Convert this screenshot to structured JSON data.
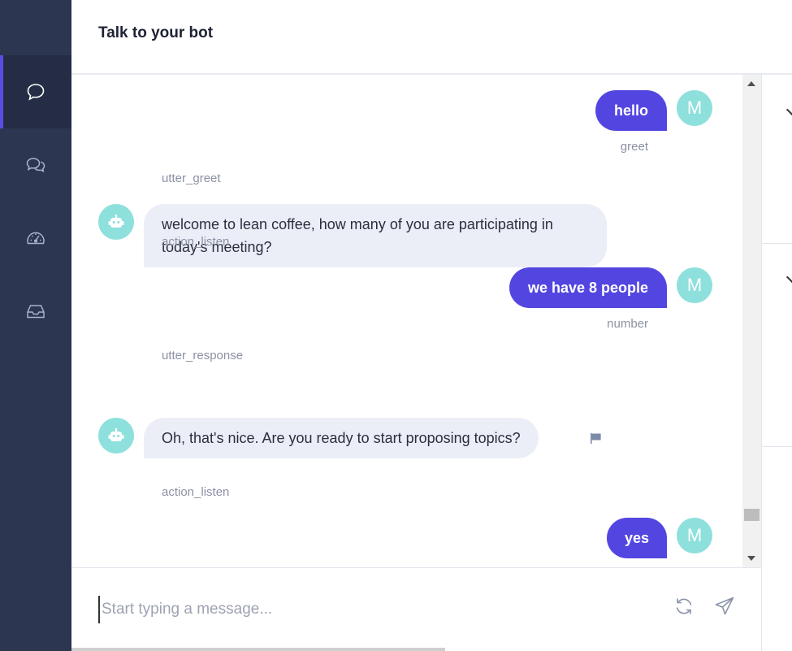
{
  "header": {
    "title": "Talk to your bot"
  },
  "sidebar": {
    "items": [
      {
        "icon": "chat-bubble-icon",
        "active": true
      },
      {
        "icon": "conversations-icon",
        "active": false
      },
      {
        "icon": "dashboard-gauge-icon",
        "active": false
      },
      {
        "icon": "inbox-icon",
        "active": false
      }
    ]
  },
  "conversation": {
    "user_messages": [
      {
        "text": "hello",
        "intent": "greet",
        "avatar": "M"
      },
      {
        "text": "we have 8 people",
        "intent": "number",
        "avatar": "M"
      },
      {
        "text": "yes",
        "avatar": "M"
      }
    ],
    "actions": [
      "utter_greet",
      "action_listen",
      "utter_response",
      "action_listen"
    ],
    "bot_messages": [
      {
        "text": "welcome to lean coffee, how many of you are participating in today's meeting?"
      },
      {
        "text": "Oh, that's nice. Are you ready to start proposing topics?"
      }
    ]
  },
  "composer": {
    "placeholder": "Start typing a message..."
  },
  "colors": {
    "sidebar": "#2c3651",
    "accent": "#5346e0",
    "avatar": "#8de0dc",
    "bot_bubble": "#eceef7"
  }
}
